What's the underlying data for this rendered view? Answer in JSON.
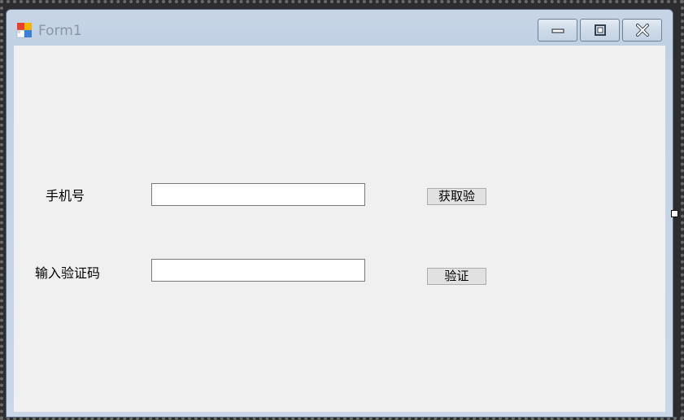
{
  "window": {
    "title": "Form1",
    "controls": {
      "minimize_icon": "minimize-icon",
      "maximize_icon": "maximize-icon",
      "close_icon": "close-icon"
    }
  },
  "form": {
    "phone_label": "手机号",
    "phone_value": "",
    "get_code_button": "获取验",
    "code_label": "输入验证码",
    "code_value": "",
    "verify_button": "验证"
  },
  "colors": {
    "client_background": "#f0f0f0",
    "title_text": "#8a96a6",
    "window_frame": "#c7d5e6"
  }
}
